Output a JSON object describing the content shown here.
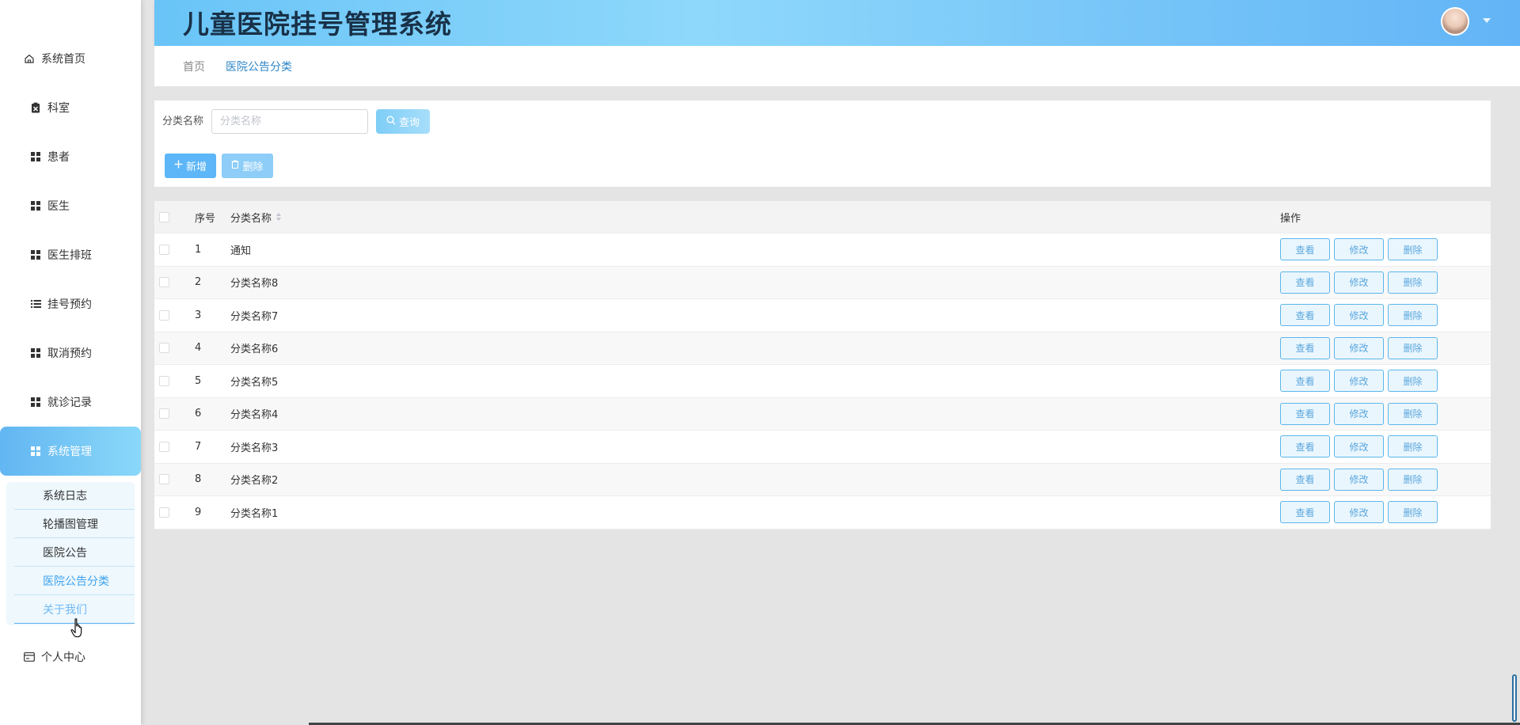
{
  "app": {
    "title": "儿童医院挂号管理系统"
  },
  "sidebar": {
    "items": [
      {
        "label": "系统首页",
        "icon": "home-icon"
      },
      {
        "label": "科室",
        "icon": "clipboard-icon"
      },
      {
        "label": "患者",
        "icon": "grid-icon"
      },
      {
        "label": "医生",
        "icon": "grid-icon"
      },
      {
        "label": "医生排班",
        "icon": "grid-icon"
      },
      {
        "label": "挂号预约",
        "icon": "list-icon"
      },
      {
        "label": "取消预约",
        "icon": "grid-icon"
      },
      {
        "label": "就诊记录",
        "icon": "grid-icon"
      },
      {
        "label": "系统管理",
        "icon": "grid-icon"
      },
      {
        "label": "个人中心",
        "icon": "card-icon"
      }
    ],
    "submenu": [
      {
        "label": "系统日志"
      },
      {
        "label": "轮播图管理"
      },
      {
        "label": "医院公告"
      },
      {
        "label": "医院公告分类"
      },
      {
        "label": "关于我们"
      }
    ]
  },
  "breadcrumb": {
    "home": "首页",
    "current": "医院公告分类"
  },
  "search": {
    "label": "分类名称",
    "placeholder": "分类名称",
    "value": "",
    "query_label": "查询"
  },
  "actions": {
    "add_label": "新增",
    "delete_label": "删除"
  },
  "table": {
    "headers": {
      "index": "序号",
      "name": "分类名称",
      "ops": "操作"
    },
    "op_labels": {
      "view": "查看",
      "edit": "修改",
      "delete": "删除"
    },
    "rows": [
      {
        "index": "1",
        "name": "通知"
      },
      {
        "index": "2",
        "name": "分类名称8"
      },
      {
        "index": "3",
        "name": "分类名称7"
      },
      {
        "index": "4",
        "name": "分类名称6"
      },
      {
        "index": "5",
        "name": "分类名称5"
      },
      {
        "index": "6",
        "name": "分类名称4"
      },
      {
        "index": "7",
        "name": "分类名称3"
      },
      {
        "index": "8",
        "name": "分类名称2"
      },
      {
        "index": "9",
        "name": "分类名称1"
      }
    ]
  },
  "colors": {
    "header_gradient_start": "#69c4f7",
    "header_gradient_end": "#62b4f6",
    "accent": "#3ea2f0",
    "title": "#183148"
  }
}
